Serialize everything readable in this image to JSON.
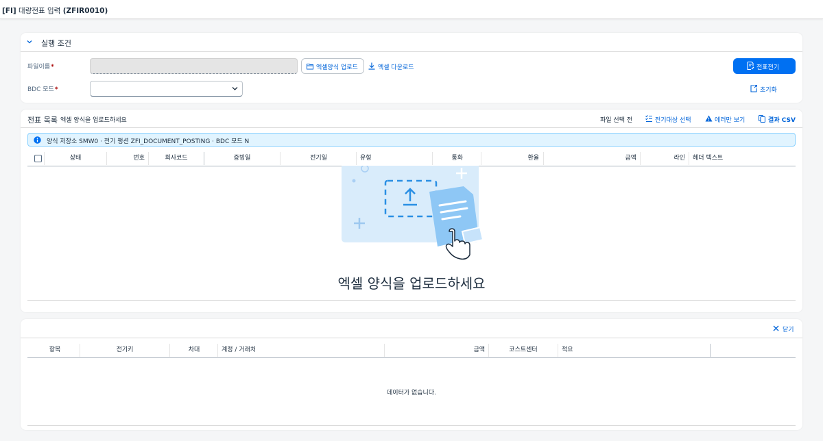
{
  "shell": {
    "prefix": "[FI]",
    "title": "대량전표 입력",
    "code": "(ZFIR0010)"
  },
  "conditions": {
    "title": "실행 조건",
    "file_label": "파일이름",
    "bdc_label": "BDC 모드",
    "required_mark": "*",
    "file_value": "",
    "bdc_value": "",
    "upload_button": "엑셀양식 업로드",
    "download_link": "엑셀 다운로드",
    "post_button": "전표전기",
    "reset_button": "초기화"
  },
  "list": {
    "title": "전표 목록",
    "subtitle": "엑셀 양식을 업로드하세요",
    "status": "파일 선택 전",
    "tools": {
      "select_label": "전기대상 선택",
      "errors_label": "에러만 보기",
      "csv_label": "결과 CSV"
    },
    "info": "양식 저장소 SMW0 · 전기 펑션 ZFI_DOCUMENT_POSTING · BDC 모드 N",
    "columns": [
      "상태",
      "번호",
      "회사코드",
      "증빙일",
      "전기일",
      "유형",
      "통화",
      "환율",
      "금액",
      "라인",
      "헤더 텍스트"
    ],
    "empty_title": "엑셀 양식을 업로드하세요",
    "colors": {
      "accent": "#0070f2",
      "info_bg": "#e1f4ff",
      "illustration": "#cfe6fb"
    }
  },
  "detail": {
    "close_label": "닫기",
    "columns": [
      "항목",
      "전기키",
      "차대",
      "계정 / 거래처",
      "금액",
      "코스트센터",
      "적요"
    ],
    "no_data": "데이터가 없습니다."
  }
}
